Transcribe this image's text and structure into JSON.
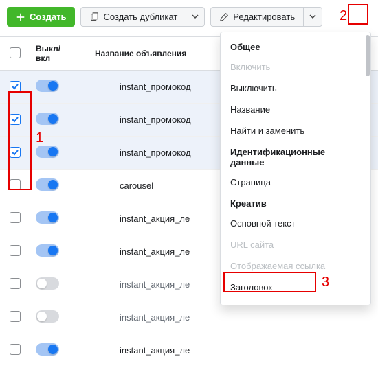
{
  "toolbar": {
    "create_label": "Создать",
    "duplicate_label": "Создать дубликат",
    "edit_label": "Редактировать"
  },
  "columns": {
    "toggle_header": "Выкл/\nвкл",
    "name_header": "Название объявления"
  },
  "rows": [
    {
      "name": "instant_промокод",
      "checked": true,
      "on": true
    },
    {
      "name": "instant_промокод",
      "checked": true,
      "on": true
    },
    {
      "name": "instant_промокод",
      "checked": true,
      "on": true
    },
    {
      "name": "carousel",
      "checked": false,
      "on": true
    },
    {
      "name": "instant_акция_ле",
      "checked": false,
      "on": true
    },
    {
      "name": "instant_акция_ле",
      "checked": false,
      "on": true
    },
    {
      "name": "instant_акция_ле",
      "checked": false,
      "on": false
    },
    {
      "name": "instant_акция_ле",
      "checked": false,
      "on": false
    },
    {
      "name": "instant_акция_ле",
      "checked": false,
      "on": true
    }
  ],
  "menu": {
    "enable_label": "Включить",
    "sections": [
      {
        "header": "Общее",
        "items": [
          {
            "label": "Включить",
            "disabled": true
          },
          {
            "label": "Выключить"
          },
          {
            "label": "Название"
          },
          {
            "label": "Найти и заменить"
          }
        ]
      },
      {
        "header": "Идентификационные данные",
        "items": [
          {
            "label": "Страница"
          }
        ]
      },
      {
        "header": "Креатив",
        "items": [
          {
            "label": "Основной текст"
          },
          {
            "label": "URL сайта",
            "disabled": true
          },
          {
            "label": "Отображаемая ссылка",
            "disabled": true
          },
          {
            "label": "Заголовок"
          }
        ]
      }
    ]
  },
  "annotations": {
    "n1": "1",
    "n2": "2",
    "n3": "3"
  }
}
